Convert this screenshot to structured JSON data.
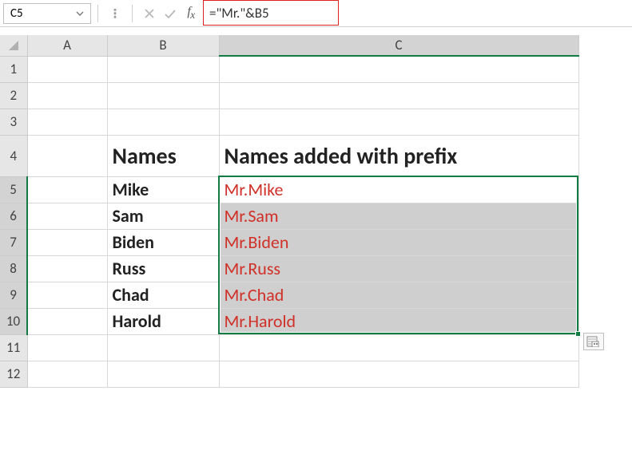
{
  "name_box": "C5",
  "formula": "=\"Mr.\"&B5",
  "columns": [
    "A",
    "B",
    "C"
  ],
  "row_count": 12,
  "selected_rows": [
    5,
    6,
    7,
    8,
    9,
    10
  ],
  "selected_col_index": 2,
  "headers": {
    "b4": "Names",
    "c4": "Names added with prefix"
  },
  "rows": [
    {
      "name": "Mike",
      "prefixed": "Mr.Mike"
    },
    {
      "name": "Sam",
      "prefixed": "Mr.Sam"
    },
    {
      "name": "Biden",
      "prefixed": "Mr.Biden"
    },
    {
      "name": "Russ",
      "prefixed": "Mr.Russ"
    },
    {
      "name": "Chad",
      "prefixed": "Mr.Chad"
    },
    {
      "name": "Harold",
      "prefixed": "Mr.Harold"
    }
  ],
  "chart_data": {
    "type": "table",
    "columns": [
      "Names",
      "Names added with prefix"
    ],
    "rows": [
      [
        "Mike",
        "Mr.Mike"
      ],
      [
        "Sam",
        "Mr.Sam"
      ],
      [
        "Biden",
        "Mr.Biden"
      ],
      [
        "Russ",
        "Mr.Russ"
      ],
      [
        "Chad",
        "Mr.Chad"
      ],
      [
        "Harold",
        "Mr.Harold"
      ]
    ]
  }
}
